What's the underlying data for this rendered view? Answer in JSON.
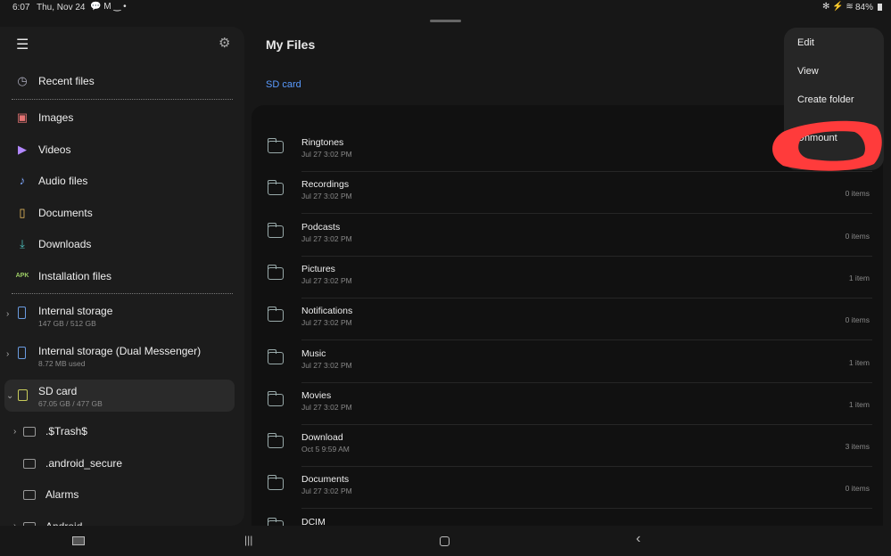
{
  "status_bar": {
    "time": "6:07",
    "date": "Thu, Nov 24",
    "battery": "84%"
  },
  "sidebar": {
    "top_items": [
      {
        "label": "Recent files",
        "icon": "clock-icon"
      }
    ],
    "categories": [
      {
        "label": "Images",
        "icon": "image-icon",
        "color": "#e57373"
      },
      {
        "label": "Videos",
        "icon": "video-icon",
        "color": "#b388ff"
      },
      {
        "label": "Audio files",
        "icon": "music-note-icon",
        "color": "#7fa8ff"
      },
      {
        "label": "Documents",
        "icon": "document-icon",
        "color": "#f0c060"
      },
      {
        "label": "Downloads",
        "icon": "download-icon",
        "color": "#4fc3c0"
      },
      {
        "label": "Installation files",
        "icon": "apk-icon",
        "icon_text": "APK",
        "color": "#9ccc65"
      }
    ],
    "storage": [
      {
        "label": "Internal storage",
        "sub": "147 GB / 512 GB"
      },
      {
        "label": "Internal storage (Dual Messenger)",
        "sub": "8.72 MB used"
      },
      {
        "label": "SD card",
        "sub": "67.05 GB / 477 GB",
        "selected": true
      }
    ],
    "sd_folders": [
      ".$Trash$",
      ".android_secure",
      "Alarms",
      "Android"
    ]
  },
  "main": {
    "title": "My Files",
    "breadcrumb": "SD card",
    "accent": "#5a9bff",
    "rows": [
      {
        "name": "Ringtones",
        "date": "Jul 27 3:02 PM",
        "count": ""
      },
      {
        "name": "Recordings",
        "date": "Jul 27 3:02 PM",
        "count": "0 items"
      },
      {
        "name": "Podcasts",
        "date": "Jul 27 3:02 PM",
        "count": "0 items"
      },
      {
        "name": "Pictures",
        "date": "Jul 27 3:02 PM",
        "count": "1 item"
      },
      {
        "name": "Notifications",
        "date": "Jul 27 3:02 PM",
        "count": "0 items"
      },
      {
        "name": "Music",
        "date": "Jul 27 3:02 PM",
        "count": "1 item"
      },
      {
        "name": "Movies",
        "date": "Jul 27 3:02 PM",
        "count": "1 item"
      },
      {
        "name": "Download",
        "date": "Oct 5 9:59 AM",
        "count": "3 items"
      },
      {
        "name": "Documents",
        "date": "Jul 27 3:02 PM",
        "count": "0 items"
      },
      {
        "name": "DCIM",
        "date": "",
        "count": ""
      }
    ]
  },
  "menu": {
    "items": [
      "Edit",
      "View",
      "Create folder",
      "Unmount"
    ],
    "highlight_color": "#ff3b3b"
  }
}
